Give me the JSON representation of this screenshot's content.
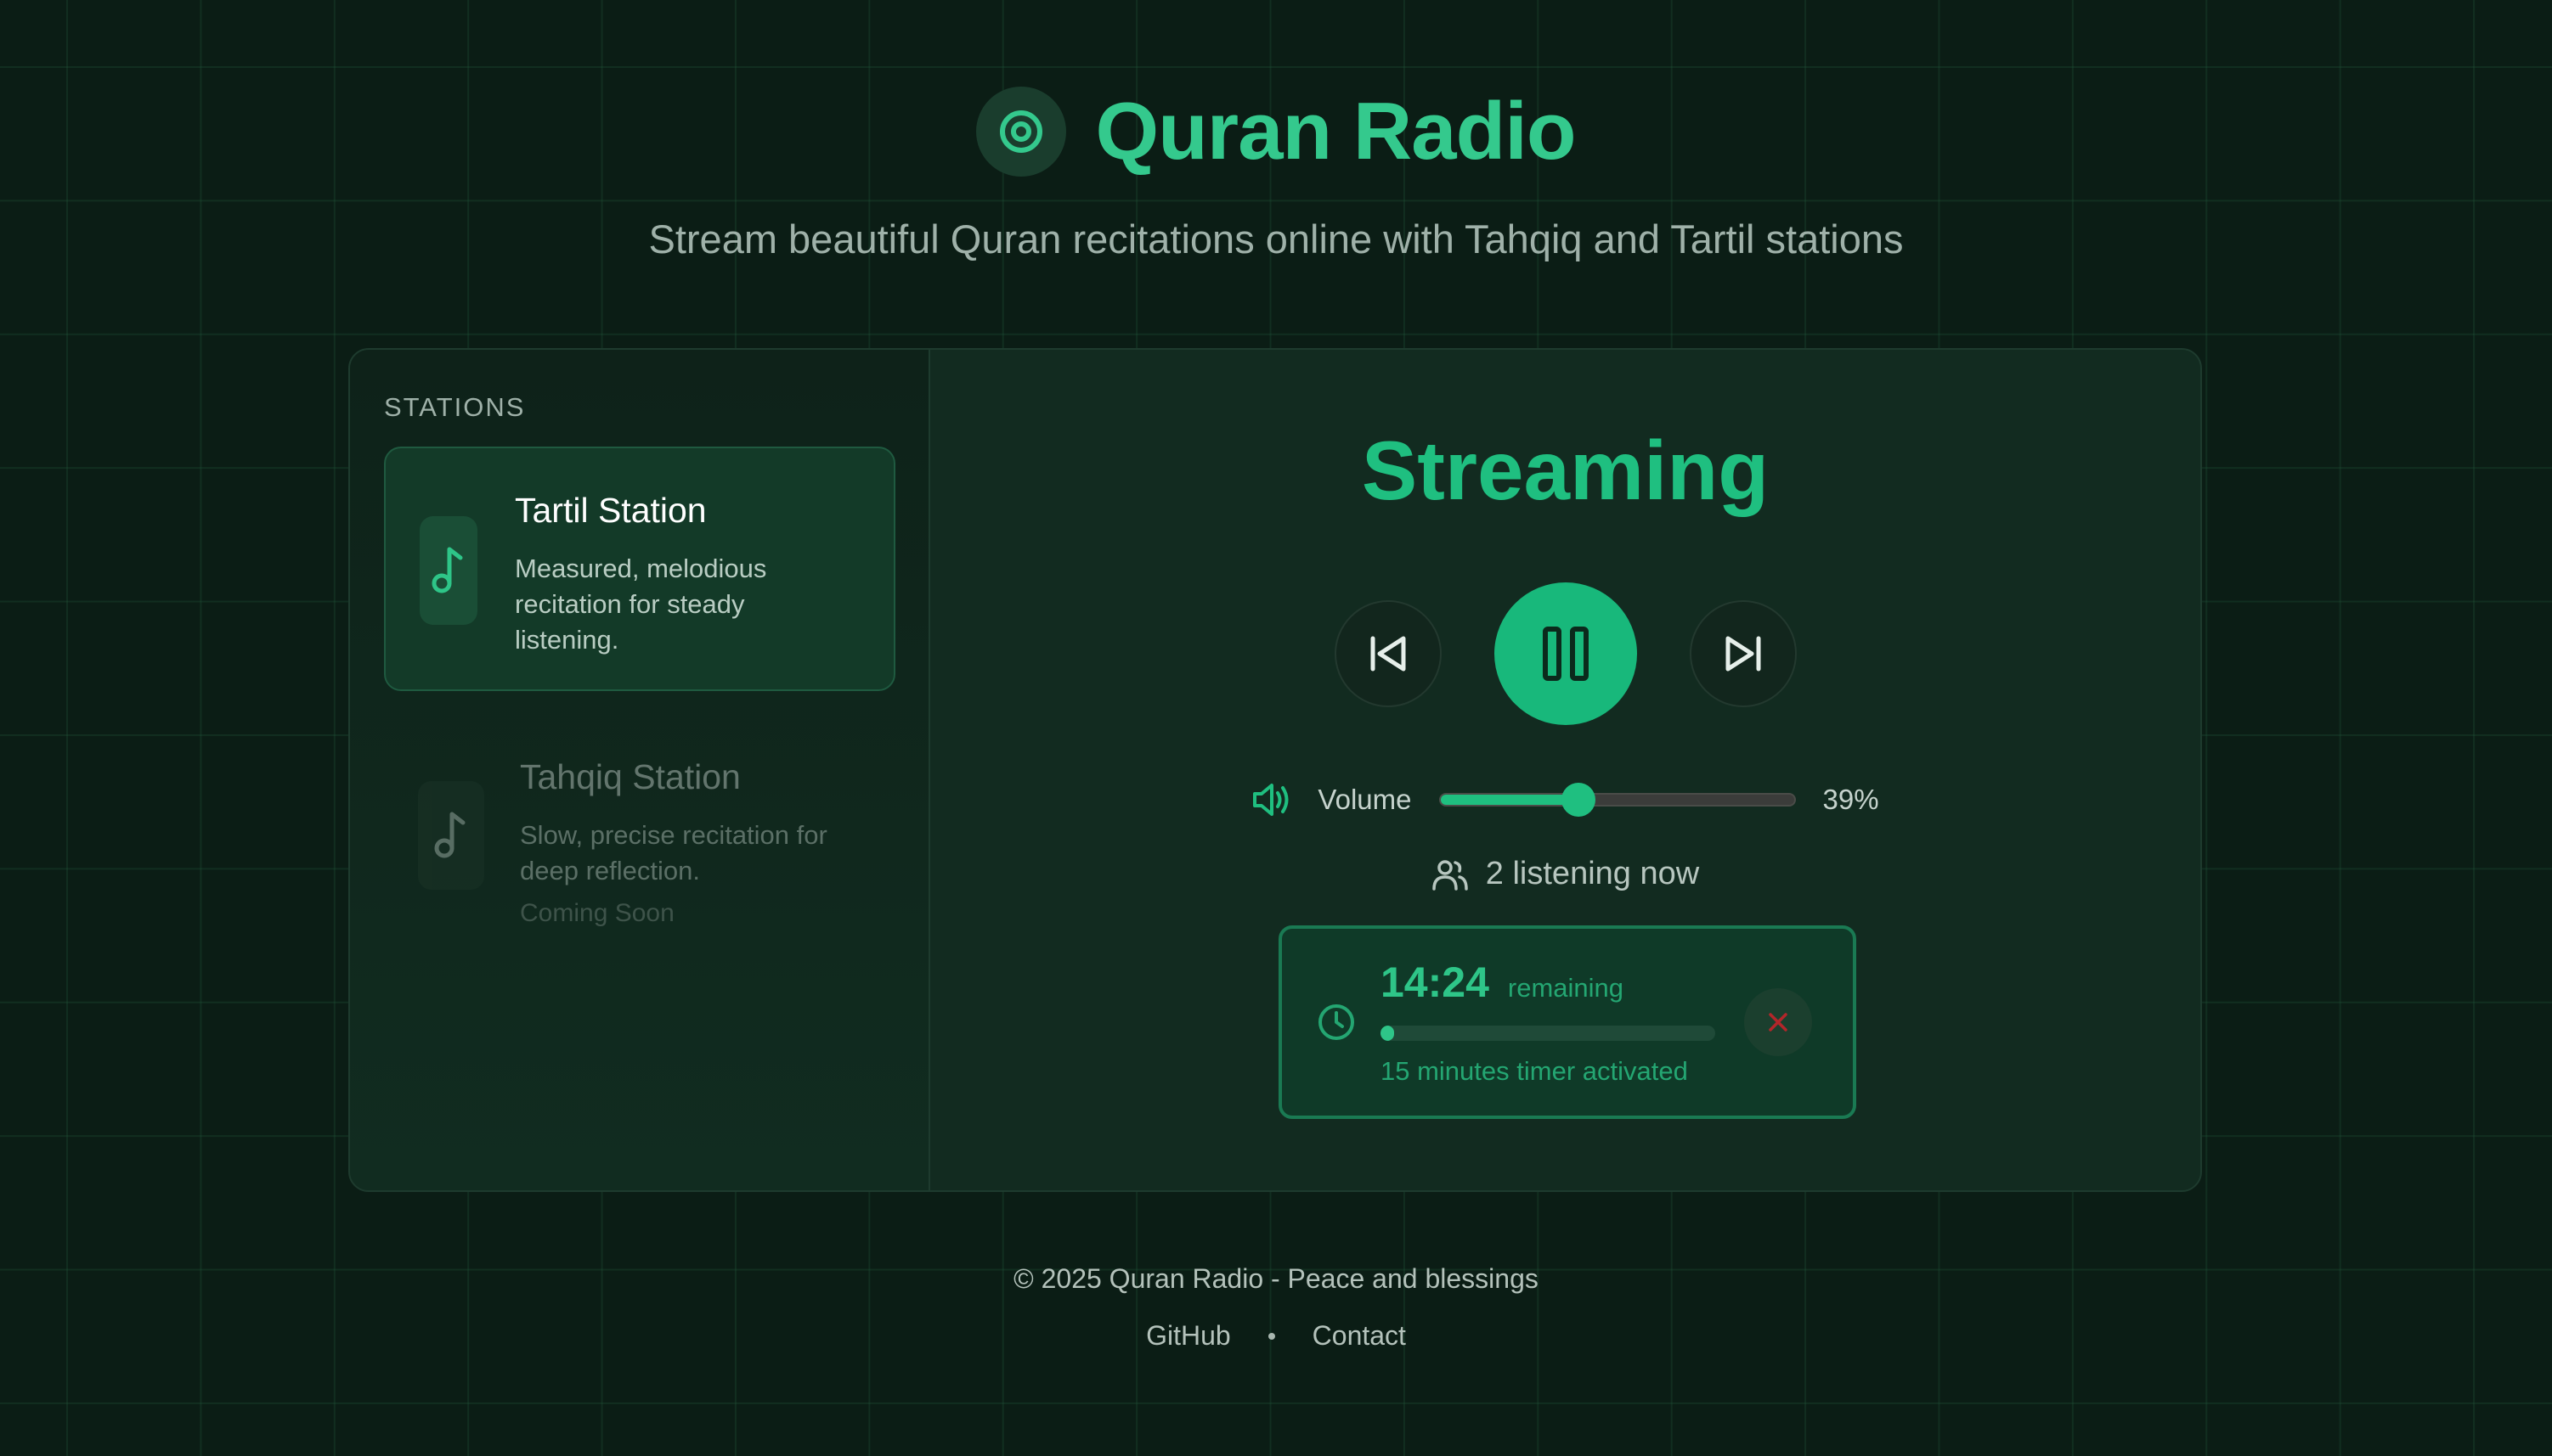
{
  "header": {
    "title": "Quran Radio",
    "subtitle": "Stream beautiful Quran recitations online with Tahqiq and Tartil stations",
    "icon": "radio-target-icon"
  },
  "sidebar": {
    "heading": "STATIONS",
    "stations": [
      {
        "name": "Tartil Station",
        "description": "Measured, melodious recitation for steady listening.",
        "icon": "music-note-icon",
        "active": true
      },
      {
        "name": "Tahqiq Station",
        "description": "Slow, precise recitation for deep reflection.",
        "status": "Coming Soon",
        "icon": "music-note-icon",
        "active": false
      }
    ]
  },
  "player": {
    "status": "Streaming",
    "controls": {
      "previous_icon": "skip-back-icon",
      "play_pause_icon": "pause-icon",
      "next_icon": "skip-forward-icon"
    },
    "volume": {
      "label": "Volume",
      "value": 39,
      "display": "39%",
      "icon": "speaker-icon"
    },
    "listeners": {
      "text": "2 listening now",
      "icon": "users-icon"
    },
    "timer": {
      "time": "14:24",
      "remaining_label": "remaining",
      "progress": 0.04,
      "note": "15 minutes timer activated",
      "icon": "clock-icon",
      "close_icon": "close-icon"
    }
  },
  "footer": {
    "copyright": "© 2025 Quran Radio - Peace and blessings",
    "links": [
      "GitHub",
      "Contact"
    ]
  },
  "colors": {
    "background": "#0b1d15",
    "accent": "#1fbf80",
    "brand": "#34c98d",
    "timer_border": "#1a7a53",
    "close_x": "#b3262a"
  }
}
